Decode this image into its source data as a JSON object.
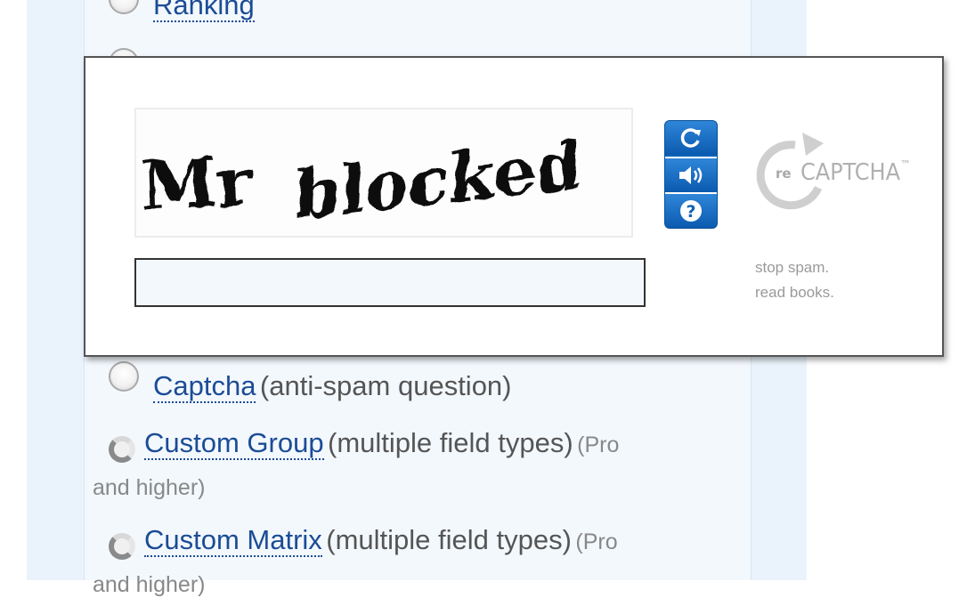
{
  "options": [
    {
      "label": "Ranking",
      "desc": "",
      "tier": ""
    },
    {
      "label": "Captcha",
      "desc": "(anti-spam question)",
      "tier": ""
    },
    {
      "label": "Custom Group",
      "desc": "(multiple field types)",
      "tier_prefix": "(Pro",
      "tier_suffix": "and higher)"
    },
    {
      "label": "Custom Matrix",
      "desc": "(multiple field types)",
      "tier_prefix": "(Pro",
      "tier_suffix": "and higher)"
    }
  ],
  "captcha": {
    "challenge_words": [
      "Mr",
      "blocked"
    ],
    "input_value": "",
    "brand_re": "re",
    "brand_name": "CAPTCHA",
    "brand_tm": "™",
    "tagline_line1": "stop spam.",
    "tagline_line2": "read books.",
    "controls": [
      {
        "icon": "refresh-icon"
      },
      {
        "icon": "audio-icon"
      },
      {
        "icon": "help-icon"
      }
    ]
  },
  "colors": {
    "link": "#1b4c96",
    "control_blue": "#0d62b8",
    "panel_bg": "#eaf3fb"
  }
}
